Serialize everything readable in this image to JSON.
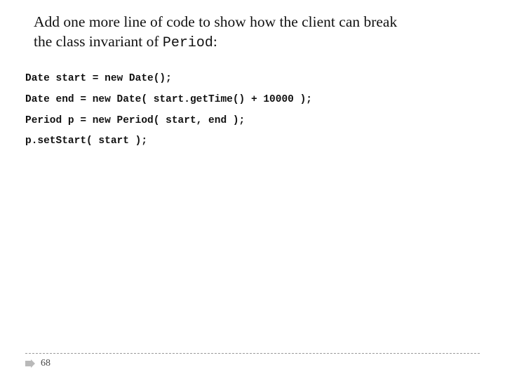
{
  "title": {
    "line1_prefix": "Add one more line of code to show how the client can break",
    "line2_prefix": "the class invariant of ",
    "period_word": "Period",
    "line2_suffix": ":"
  },
  "code": {
    "l1": "Date start = new Date();",
    "l2": "Date end = new Date( start.getTime() + 10000 );",
    "l3": "Period p = new Period( start, end );",
    "l4": "p.setStart( start );"
  },
  "footer": {
    "page_number": "68"
  }
}
